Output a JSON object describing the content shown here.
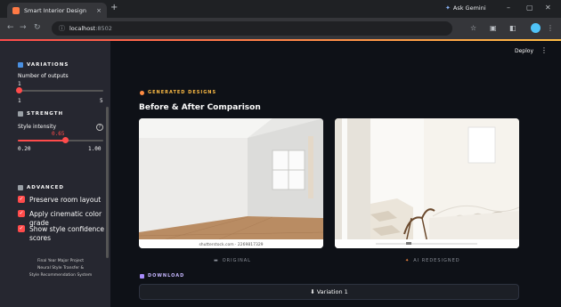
{
  "browser": {
    "tab_title": "Smart Interior Design",
    "tab_close": "×",
    "new_tab": "+",
    "ask_gemini": "Ask Gemini",
    "host": "localhost",
    "port": ":8502",
    "minimize": "–",
    "maximize": "▢",
    "close": "✕"
  },
  "header": {
    "deploy": "Deploy",
    "menu": "⋮"
  },
  "sidebar": {
    "variations_heading": "VARIATIONS",
    "num_outputs_label": "Number of outputs",
    "num_outputs_value": "1",
    "num_outputs_min": "1",
    "num_outputs_max": "5",
    "strength_heading": "STRENGTH",
    "style_intensity_label": "Style intensity",
    "style_intensity_value": "0.65",
    "style_min": "0.20",
    "style_max": "1.00",
    "style_fraction": 0.56,
    "advanced_heading": "ADVANCED",
    "options": [
      {
        "label": "Preserve room layout",
        "checked": true
      },
      {
        "label": "Apply cinematic color grade",
        "checked": true
      },
      {
        "label": "Show style confidence scores",
        "checked": true
      }
    ],
    "footer_line1": "Final Year Major Project",
    "footer_line2": "Neural Style Transfer &",
    "footer_line3": "Style Recommendation System"
  },
  "main": {
    "generated_heading": "GENERATED DESIGNS",
    "title": "Before & After Comparison",
    "before_watermark": "shutterstock.com · 2269817329",
    "before_caption": "ORIGINAL",
    "after_caption": "AI REDESIGNED",
    "download_heading": "DOWNLOAD",
    "variation_button": "⬇ Variation 1"
  },
  "colors": {
    "accent": "#ff4b4b",
    "sidebar_bg": "#262730",
    "main_bg": "#0e1117"
  }
}
